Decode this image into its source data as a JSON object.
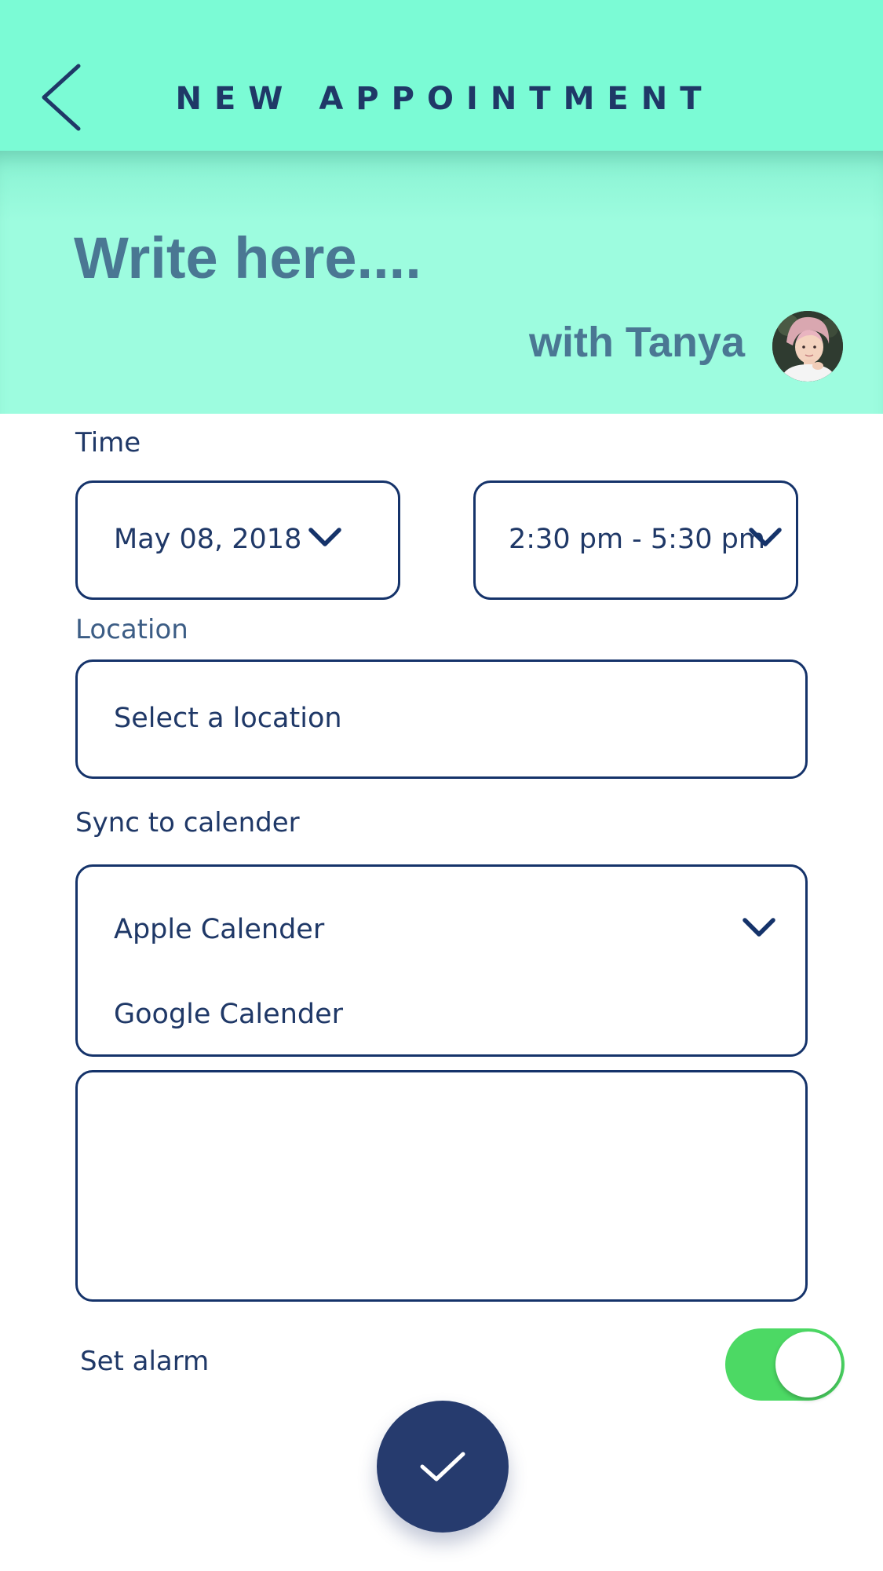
{
  "header": {
    "title": "NEW APPOINTMENT",
    "back_icon": "chevron-left-icon",
    "background_color": "#7BFBD5"
  },
  "hero": {
    "subject_placeholder": "Write here....",
    "with_label": "with Tanya",
    "avatar": "avatar-photo"
  },
  "form": {
    "time_label": "Time",
    "date_value": "May 08, 2018",
    "time_range_value": "2:30 pm - 5:30 pm",
    "location_label": "Location",
    "location_placeholder": "Select a location",
    "sync_label": "Sync to calender",
    "calendar_options": [
      "Apple Calender",
      "Google Calender"
    ],
    "notes_value": "",
    "alarm_label": "Set alarm",
    "alarm_on": true
  },
  "colors": {
    "accent": "#7BFBD5",
    "navy": "#1F3867",
    "toggle_on": "#4CD964",
    "confirm": "#263B6E"
  },
  "actions": {
    "confirm_icon": "check-icon"
  }
}
